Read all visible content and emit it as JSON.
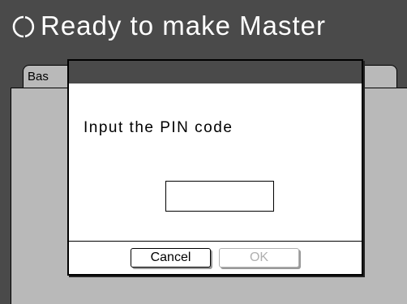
{
  "status": {
    "icon": "circle-outline-icon",
    "text": "Ready to make Master"
  },
  "tabs": {
    "left_label": "Bas",
    "right_label": "."
  },
  "dialog": {
    "message": "Input the PIN code",
    "pin_value": "",
    "cancel_label": "Cancel",
    "ok_label": "OK",
    "ok_enabled": false
  },
  "colors": {
    "background_dark": "#4a4a4a",
    "panel_gray": "#b9b9b9",
    "dialog_white": "#ffffff",
    "disabled_text": "#b0b0b0"
  }
}
